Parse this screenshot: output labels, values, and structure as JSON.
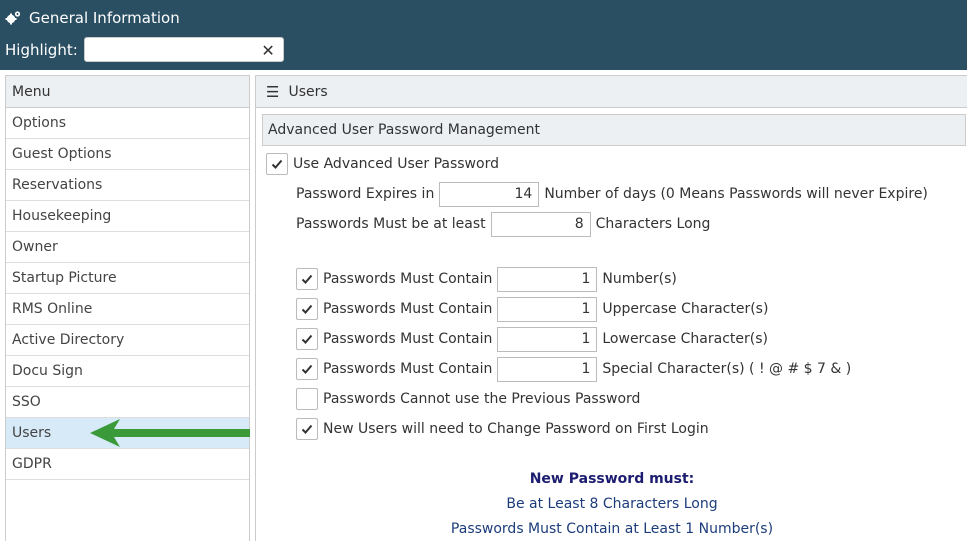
{
  "header": {
    "title": "General Information",
    "highlight_label": "Highlight:",
    "highlight_value": "",
    "clear_glyph": "✕"
  },
  "menu": {
    "heading": "Menu",
    "items": [
      "Options",
      "Guest Options",
      "Reservations",
      "Housekeeping",
      "Owner",
      "Startup Picture",
      "RMS Online",
      "Active Directory",
      "Docu Sign",
      "SSO",
      "Users",
      "GDPR"
    ],
    "active": "Users"
  },
  "panel": {
    "title": "Users",
    "section_title": "Advanced User Password Management",
    "use_advanced": {
      "label": "Use Advanced User Password",
      "checked": true
    },
    "expires": {
      "prefix": "Password Expires in",
      "value": "14",
      "suffix": "Number of days (0 Means Passwords will never Expire)"
    },
    "min_length": {
      "prefix": "Passwords Must be at least",
      "value": "8",
      "suffix": "Characters Long"
    },
    "rules": [
      {
        "label": "Passwords Must Contain",
        "value": "1",
        "suffix": "Number(s)",
        "checked": true
      },
      {
        "label": "Passwords Must Contain",
        "value": "1",
        "suffix": "Uppercase Character(s)",
        "checked": true
      },
      {
        "label": "Passwords Must Contain",
        "value": "1",
        "suffix": "Lowercase Character(s)",
        "checked": true
      },
      {
        "label": "Passwords Must Contain",
        "value": "1",
        "suffix": "Special Character(s) ( ! @ # $ 7 & )",
        "checked": true
      }
    ],
    "no_previous": {
      "label": "Passwords Cannot use the Previous Password",
      "checked": false
    },
    "change_first_login": {
      "label": "New Users will need to Change Password on First Login",
      "checked": true
    },
    "info": {
      "title": "New Password must:",
      "lines": [
        "Be at Least 8 Characters Long",
        "Passwords Must Contain at Least 1 Number(s)"
      ]
    }
  },
  "colors": {
    "header_bg": "#2a4f63",
    "active_menu_bg": "#d6eaf8",
    "arrow": "#3a9a3a",
    "info_title": "#1c1c70"
  }
}
